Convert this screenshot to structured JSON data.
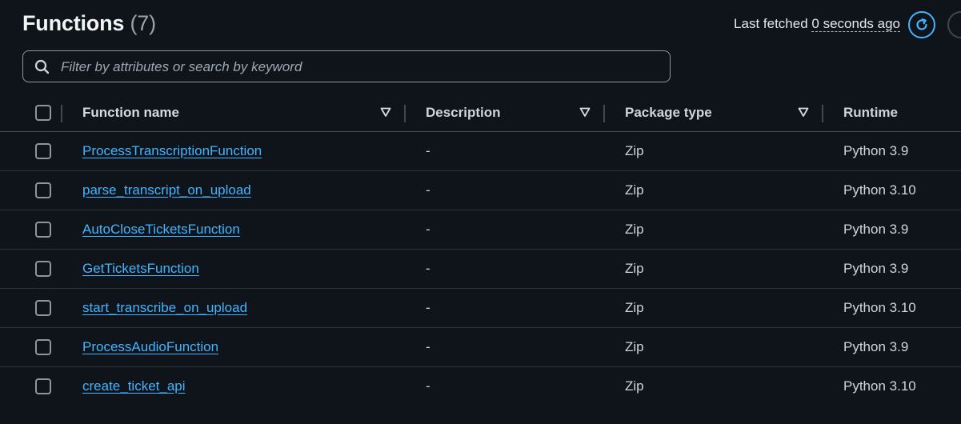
{
  "header": {
    "title": "Functions",
    "count": "(7)"
  },
  "fetch": {
    "prefix": "Last fetched",
    "ago": "0 seconds ago"
  },
  "search": {
    "placeholder": "Filter by attributes or search by keyword",
    "value": ""
  },
  "table": {
    "columns": [
      "Function name",
      "Description",
      "Package type",
      "Runtime"
    ],
    "rows": [
      {
        "name": "ProcessTranscriptionFunction",
        "description": "-",
        "package_type": "Zip",
        "runtime": "Python 3.9"
      },
      {
        "name": "parse_transcript_on_upload",
        "description": "-",
        "package_type": "Zip",
        "runtime": "Python 3.10"
      },
      {
        "name": "AutoCloseTicketsFunction",
        "description": "-",
        "package_type": "Zip",
        "runtime": "Python 3.9"
      },
      {
        "name": "GetTicketsFunction",
        "description": "-",
        "package_type": "Zip",
        "runtime": "Python 3.9"
      },
      {
        "name": "start_transcribe_on_upload",
        "description": "-",
        "package_type": "Zip",
        "runtime": "Python 3.10"
      },
      {
        "name": "ProcessAudioFunction",
        "description": "-",
        "package_type": "Zip",
        "runtime": "Python 3.9"
      },
      {
        "name": "create_ticket_api",
        "description": "-",
        "package_type": "Zip",
        "runtime": "Python 3.10"
      }
    ]
  },
  "colors": {
    "background": "#0f141a",
    "link": "#42b4ff",
    "accent": "#42b4ff"
  }
}
